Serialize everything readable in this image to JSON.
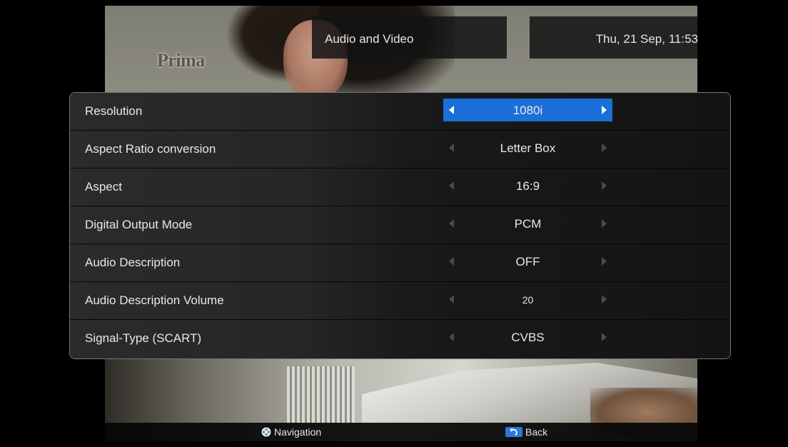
{
  "header": {
    "title": "Audio and Video",
    "datetime": "Thu, 21 Sep, 11:53"
  },
  "channel_logo": "Prima",
  "settings": [
    {
      "label": "Resolution",
      "value": "1080i",
      "selected": true
    },
    {
      "label": "Aspect Ratio conversion",
      "value": "Letter Box",
      "selected": false
    },
    {
      "label": "Aspect",
      "value": "16:9",
      "selected": false
    },
    {
      "label": "Digital Output Mode",
      "value": "PCM",
      "selected": false
    },
    {
      "label": "Audio Description",
      "value": "OFF",
      "selected": false
    },
    {
      "label": "Audio Description Volume",
      "value": "20",
      "selected": false
    },
    {
      "label": "Signal-Type (SCART)",
      "value": "CVBS",
      "selected": false
    }
  ],
  "hints": {
    "navigation": "Navigation",
    "back": "Back"
  },
  "colors": {
    "selection": "#1b6fd8",
    "panel_border": "#777777",
    "text": "#e8e8e8"
  },
  "icons": {
    "navigation": "dpad-icon",
    "back": "back-arrow-icon",
    "left": "arrow-left-icon",
    "right": "arrow-right-icon"
  }
}
